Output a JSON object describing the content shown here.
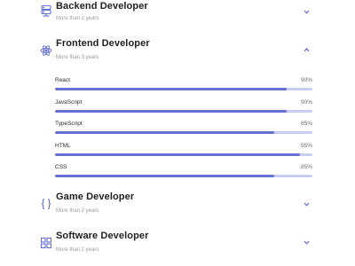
{
  "theme": {
    "accent": "#6570d3",
    "track": "#c9cdf3"
  },
  "qualifications": [
    {
      "title": "Backend Developer",
      "subtitle": "More than 2 years",
      "icon": "server-icon",
      "expanded": false
    },
    {
      "title": "Frontend Developer",
      "subtitle": "More than 3 years",
      "icon": "react-atom-icon",
      "expanded": true,
      "skills": [
        {
          "name": "React",
          "percent_label": "90%",
          "level": 0.9
        },
        {
          "name": "JavaScript",
          "percent_label": "90%",
          "level": 0.9
        },
        {
          "name": "TypeScript",
          "percent_label": "85%",
          "level": 0.85
        },
        {
          "name": "HTML",
          "percent_label": "95%",
          "level": 0.95
        },
        {
          "name": "CSS",
          "percent_label": "85%",
          "level": 0.85
        }
      ]
    },
    {
      "title": "Game Developer",
      "subtitle": "More than 2 years",
      "icon": "braces-icon",
      "expanded": false
    },
    {
      "title": "Software Developer",
      "subtitle": "More than 2 years",
      "icon": "grid-icon",
      "expanded": false
    }
  ]
}
